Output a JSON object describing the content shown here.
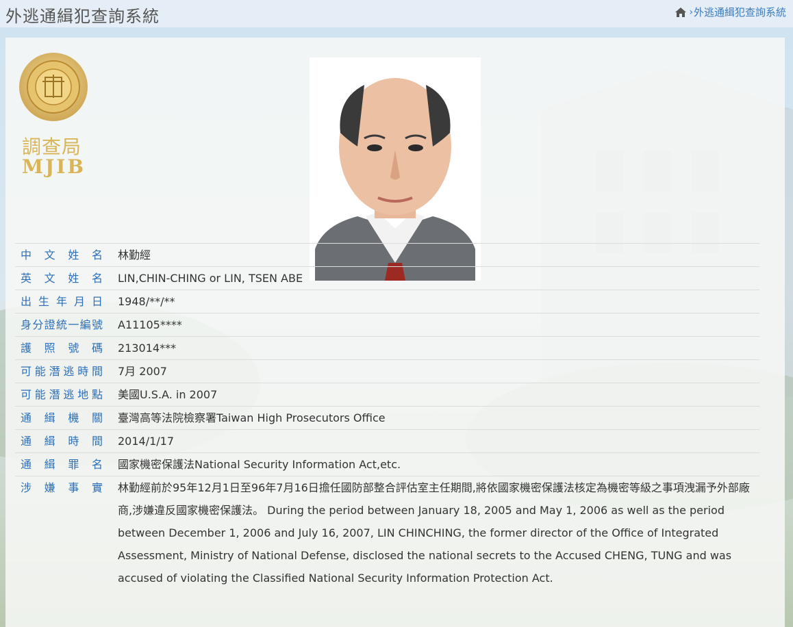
{
  "header": {
    "title": "外逃通緝犯查詢系統",
    "breadcrumb_current": "外逃通緝犯查詢系統",
    "breadcrumb_separator": "›"
  },
  "logo": {
    "text_cn": "調查局",
    "text_en": "MJIB"
  },
  "colors": {
    "label": "#2d6fb8",
    "breadcrumb": "#3a7bbf",
    "logo_gold": "#d9b458"
  },
  "fields": [
    {
      "label": "中文姓名",
      "value": "林勤經"
    },
    {
      "label": "英文姓名",
      "value": "LIN,CHIN-CHING or LIN, TSEN ABE"
    },
    {
      "label": "出生年月日",
      "value": "1948/**/**"
    },
    {
      "label": "身分證統一編號",
      "value": "A11105****"
    },
    {
      "label": "護照號碼",
      "value": "213014***"
    },
    {
      "label": "可能潛逃時間",
      "value": "7月 2007"
    },
    {
      "label": "可能潛逃地點",
      "value": "美國U.S.A. in 2007"
    },
    {
      "label": "通緝機關",
      "value": "臺灣高等法院檢察署Taiwan High Prosecutors Office"
    },
    {
      "label": "通緝時間",
      "value": "2014/1/17"
    },
    {
      "label": "通緝罪名",
      "value": "國家機密保護法National Security Information Act,etc."
    },
    {
      "label": "涉嫌事實",
      "value": "林勤經前於95年12月1日至96年7月16日擔任國防部整合評估室主任期間,將依國家機密保護法核定為機密等級之事項洩漏予外部廠商,涉嫌違反國家機密保護法。 During the period between January 18, 2005 and May 1, 2006 as well as the period between December 1, 2006 and July 16, 2007, LIN CHINCHING, the former director of the Office of Integrated Assessment, Ministry of National Defense, disclosed the national secrets to the Accused CHENG, TUNG and was accused of violating the Classified National Security Information Protection Act."
    }
  ]
}
